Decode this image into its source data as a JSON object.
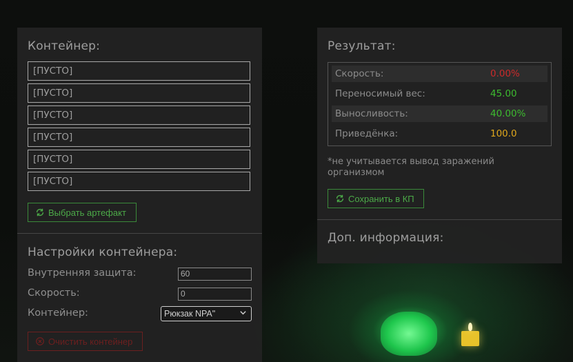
{
  "container_panel": {
    "title": "Контейнер:",
    "slots": [
      "[ПУСТО]",
      "[ПУСТО]",
      "[ПУСТО]",
      "[ПУСТО]",
      "[ПУСТО]",
      "[ПУСТО]"
    ],
    "select_artifact_label": "Выбрать артефакт"
  },
  "settings": {
    "title": "Настройки контейнера:",
    "inner_protection_label": "Внутренняя защита:",
    "inner_protection_value": "60",
    "speed_label": "Скорость:",
    "speed_value": "0",
    "container_label": "Контейнер:",
    "container_selected": "Рюкзак NPA\"",
    "clear_button_label": "Очистить контейнер"
  },
  "result_panel": {
    "title": "Результат:",
    "rows": [
      {
        "label": "Скорость:",
        "value": "0.00%",
        "color": "#cc2a2a"
      },
      {
        "label": "Переносимый вес:",
        "value": "45.00",
        "color": "#3dbb2f"
      },
      {
        "label": "Выносливость:",
        "value": "40.00%",
        "color": "#3dbb2f"
      },
      {
        "label": "Приведёнка:",
        "value": "100.0",
        "color": "#e0a81c"
      }
    ],
    "note": "*не учитывается вывод заражений организмом",
    "save_button_label": "Сохранить в КП",
    "extra_info_title": "Доп. информация:"
  },
  "colors": {
    "accent_green": "#3b8a3a",
    "danger_red": "#6b1f1f"
  },
  "icons": {
    "refresh": "refresh-icon",
    "clear": "cancel-circle-icon",
    "dropdown": "chevron-down-icon"
  }
}
